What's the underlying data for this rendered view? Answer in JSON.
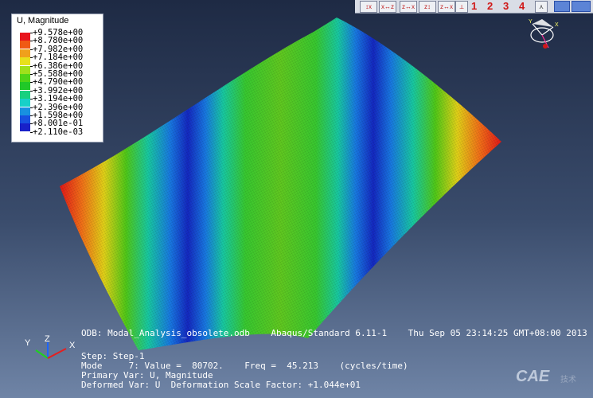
{
  "legend": {
    "title": "U, Magnitude",
    "entries": [
      {
        "label": "+9.578e+00",
        "color": "#e8141c"
      },
      {
        "label": "+8.780e+00",
        "color": "#f05a14"
      },
      {
        "label": "+7.982e+00",
        "color": "#f0a01c"
      },
      {
        "label": "+7.184e+00",
        "color": "#e8e01c"
      },
      {
        "label": "+6.386e+00",
        "color": "#a0e01c"
      },
      {
        "label": "+5.588e+00",
        "color": "#50d418"
      },
      {
        "label": "+4.790e+00",
        "color": "#20c828"
      },
      {
        "label": "+3.992e+00",
        "color": "#18d080"
      },
      {
        "label": "+3.194e+00",
        "color": "#18d0c8"
      },
      {
        "label": "+2.396e+00",
        "color": "#1890e0"
      },
      {
        "label": "+1.598e+00",
        "color": "#1850e0"
      },
      {
        "label": "+8.001e-01",
        "color": "#1820c8"
      },
      {
        "label": "+2.110e-03",
        "color": ""
      }
    ]
  },
  "toolbar": {
    "view_numbers": [
      "1",
      "2",
      "3",
      "4"
    ],
    "view_icon_names": [
      "view-x-icon",
      "view-xz-icon",
      "view-zx-icon",
      "view-zz-icon",
      "view-yz-icon",
      "view-iso-icon",
      "view-persp-icon"
    ]
  },
  "info": {
    "odb": "ODB: Modal_Analysis_obsolete.odb    Abaqus/Standard 6.11-1    Thu Sep 05 23:14:25 GMT+08:00 2013",
    "step": "Step: Step-1",
    "mode": "Mode     7: Value =  80702.    Freq =  45.213    (cycles/time)",
    "primary": "Primary Var: U, Magnitude",
    "deformed": "Deformed Var: U  Deformation Scale Factor: +1.044e+01"
  },
  "triad": {
    "x": "X",
    "y": "Y",
    "z": "Z"
  },
  "watermark": {
    "text": "CAE",
    "sub": "技术"
  }
}
